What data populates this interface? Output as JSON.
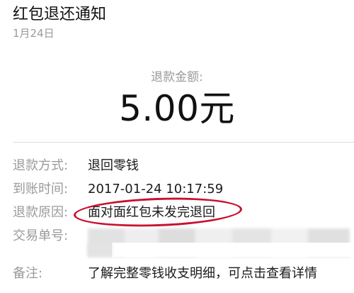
{
  "header": {
    "title": "红包退还通知",
    "date": "1月24日"
  },
  "amount": {
    "label": "退款金额:",
    "value": "5.00元"
  },
  "details": {
    "refund_method_key": "退款方式:",
    "refund_method_value": "退回零钱",
    "arrival_time_key": "到账时间:",
    "arrival_time_value": "2017-01-24 10:17:59",
    "refund_reason_key": "退款原因:",
    "refund_reason_value": "面对面红包未发完退回",
    "transaction_id_key": "交易单号:",
    "remark_key": "备注:",
    "remark_value": "了解完整零钱收支明细，可点击查看详情"
  },
  "colors": {
    "annotation": "#c8102e",
    "label": "#9a9a9a",
    "text": "#1a1a1a"
  }
}
